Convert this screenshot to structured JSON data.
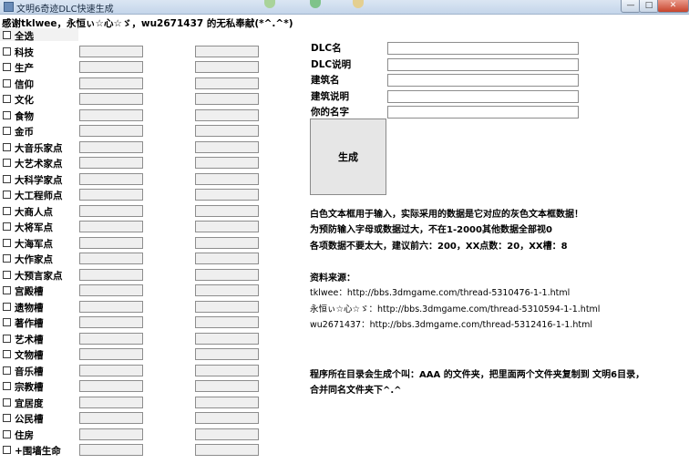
{
  "window": {
    "title": "文明6奇迹DLC快速生成",
    "minimize_label": "—",
    "maximize_label": "□",
    "close_label": "✕"
  },
  "thanks_text": "感谢tklwee，永恒ぃ☆心☆ゞ，wu2671437 的无私奉献(*^.^*)",
  "select_all_label": "全选",
  "rows": [
    {
      "label": "科技"
    },
    {
      "label": "生产"
    },
    {
      "label": "信仰"
    },
    {
      "label": "文化"
    },
    {
      "label": "食物"
    },
    {
      "label": "金币"
    },
    {
      "label": "大音乐家点"
    },
    {
      "label": "大艺术家点"
    },
    {
      "label": "大科学家点"
    },
    {
      "label": "大工程师点"
    },
    {
      "label": "大商人点"
    },
    {
      "label": "大将军点"
    },
    {
      "label": "大海军点"
    },
    {
      "label": "大作家点"
    },
    {
      "label": "大预言家点"
    },
    {
      "label": "宫殿槽"
    },
    {
      "label": "遗物槽"
    },
    {
      "label": "著作槽"
    },
    {
      "label": "艺术槽"
    },
    {
      "label": "文物槽"
    },
    {
      "label": "音乐槽"
    },
    {
      "label": "宗教槽"
    },
    {
      "label": "宜居度"
    },
    {
      "label": "公民槽"
    },
    {
      "label": "住房"
    },
    {
      "label": "+围墙生命"
    }
  ],
  "form": {
    "dlc_name_label": "DLC名",
    "dlc_desc_label": "DLC说明",
    "building_name_label": "建筑名",
    "building_desc_label": "建筑说明",
    "your_name_label": "你的名字",
    "dlc_name_value": "",
    "dlc_desc_value": "",
    "building_name_value": "",
    "building_desc_value": "",
    "your_name_value": ""
  },
  "generate_label": "生成",
  "info": {
    "line1": "白色文本框用于输入，实际采用的数据是它对应的灰色文本框数据！",
    "line2": "为预防输入字母或数据过大，不在1-2000其他数据全部视0",
    "line3": "各项数据不要太大，建议前六：200，XX点数：20，XX槽：8"
  },
  "sources": {
    "heading": "资料来源：",
    "src1": "tklwee：http://bbs.3dmgame.com/thread-5310476-1-1.html",
    "src2": "永恒ぃ☆心☆ゞ：http://bbs.3dmgame.com/thread-5310594-1-1.html",
    "src3": "wu2671437：http://bbs.3dmgame.com/thread-5312416-1-1.html"
  },
  "note": {
    "line1": "程序所在目录会生成个叫：AAA 的文件夹，把里面两个文件夹复制到 文明6目录，",
    "line2": "合并同名文件夹下^.^"
  }
}
